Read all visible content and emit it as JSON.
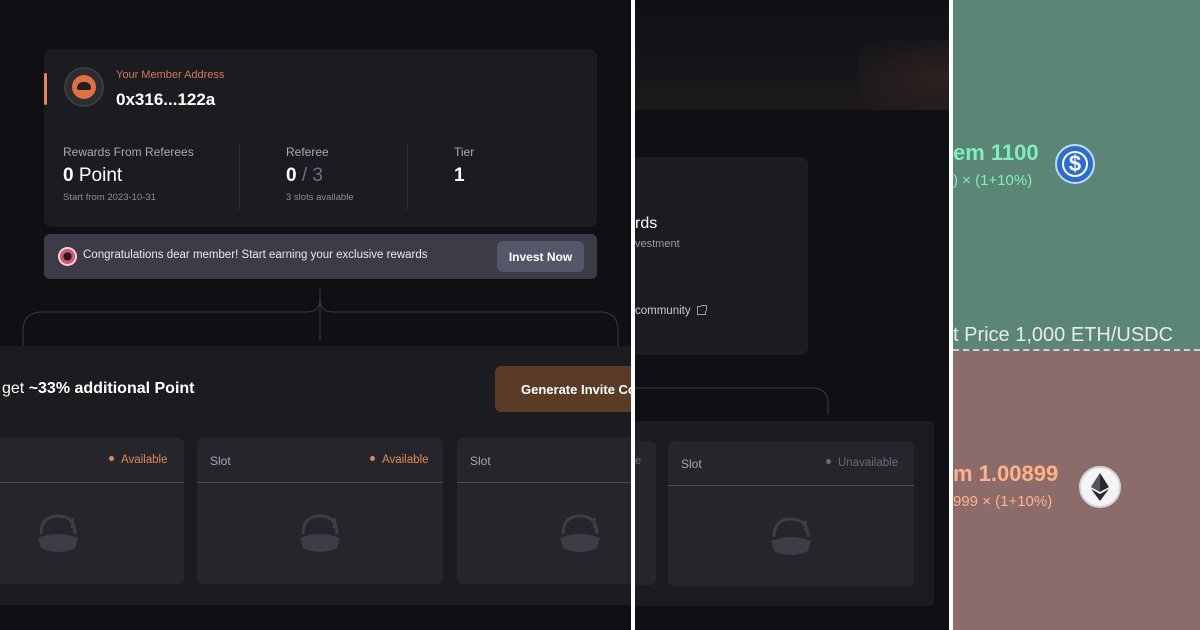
{
  "panel1": {
    "member": {
      "address_label": "Your Member Address",
      "address": "0x316...122a"
    },
    "stats": {
      "rewards": {
        "label": "Rewards From Referees",
        "value": "0",
        "unit": "Point",
        "sub": "Start from 2023-10-31"
      },
      "referee": {
        "label": "Referee",
        "value": "0",
        "slash": "/",
        "total": "3",
        "sub": "3 slots available"
      },
      "tier": {
        "label": "Tier",
        "value": "1"
      }
    },
    "congrats": {
      "text": "Congratulations dear member! Start earning your exclusive rewards",
      "button": "Invest Now"
    },
    "invite": {
      "text_prefix": "get ",
      "text_bold": "~33% additional Point",
      "button": "Generate Invite Co"
    },
    "slots": [
      {
        "title": "",
        "status": "Available"
      },
      {
        "title": "Slot",
        "status": "Available"
      },
      {
        "title": "Slot",
        "status": ""
      }
    ]
  },
  "panel2": {
    "rewards_text": "rds",
    "invest_text": "vestment",
    "community_text": "community",
    "slot_left_edge": "e",
    "slot": {
      "title": "Slot",
      "status": "Unavailable"
    }
  },
  "panel3": {
    "usdc_label": "em 1100",
    "usdc_sub": ") × (1+10%)",
    "price_label": "t Price   1,000 ETH/USDC",
    "eth_label": "m 1.00899",
    "eth_sub": "999 × (1+10%)",
    "colors": {
      "top_bg": "#5b8575",
      "bottom_bg": "#8c6c6a",
      "usdc_text": "#7ff0b9",
      "eth_text": "#ffb28a"
    }
  },
  "icons": [
    "member-avatar-icon",
    "rewards-badge-icon",
    "helmet-icon",
    "external-link-icon",
    "usdc-icon",
    "eth-icon"
  ],
  "colors": {
    "accent": "#e9845a",
    "available": "#e1884f",
    "unavailable": "#686a77",
    "card_bg": "#1b1c20"
  }
}
